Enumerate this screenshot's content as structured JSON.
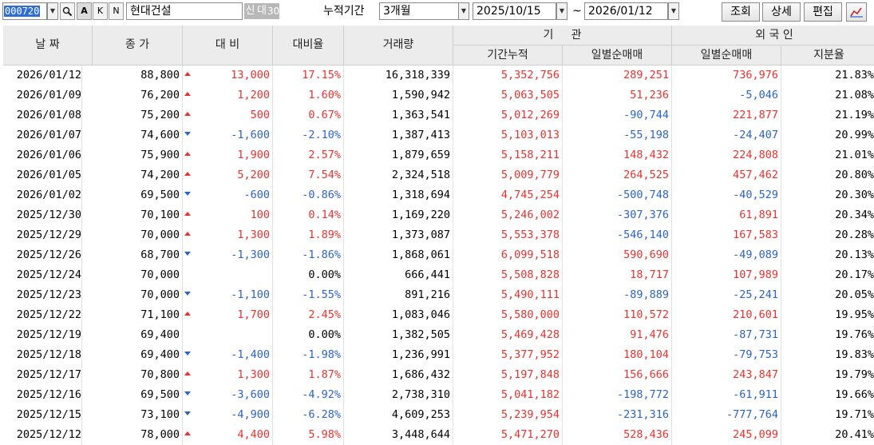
{
  "toolbar": {
    "code": "000720",
    "btn_search_icon": "magnifier-icon",
    "btn_a": "A",
    "btn_k": "K",
    "btn_n": "N",
    "name": "현대건설",
    "tag_new": "신",
    "tag_loan": "대",
    "tag_30": "30",
    "period_label": "누적기간",
    "period_value": "3개월",
    "date_from": "2025/10/15",
    "tilde": "~",
    "date_to": "2026/01/12",
    "btn_query": "조회",
    "btn_detail": "상세",
    "btn_edit": "편집"
  },
  "headers": {
    "date": "날 짜",
    "close": "종 가",
    "change": "대 비",
    "change_rate": "대비율",
    "volume": "거래량",
    "institution": "기     관",
    "inst_cum": "기간누적",
    "inst_daily": "일별순매매",
    "foreign": "외 국 인",
    "frgn_daily": "일별순매매",
    "frgn_share": "지분율"
  },
  "colors": {
    "up": "#e8322e",
    "down": "#2b63c6",
    "header_bg": "#ececec",
    "select_blue": "#2f6fd4"
  },
  "rows": [
    {
      "date": "2026/01/12",
      "close": "88,800",
      "dir": "up",
      "change": "13,000",
      "rate": "17.15%",
      "volume": "16,318,339",
      "inst_cum": "5,352,756",
      "inst_daily": "289,251",
      "frgn_daily": "736,976",
      "share": "21.83%"
    },
    {
      "date": "2026/01/09",
      "close": "76,200",
      "dir": "up",
      "change": "1,200",
      "rate": "1.60%",
      "volume": "1,590,942",
      "inst_cum": "5,063,505",
      "inst_daily": "51,236",
      "frgn_daily": "-5,046",
      "share": "21.08%"
    },
    {
      "date": "2026/01/08",
      "close": "75,200",
      "dir": "up",
      "change": "500",
      "rate": "0.67%",
      "volume": "1,363,541",
      "inst_cum": "5,012,269",
      "inst_daily": "-90,744",
      "frgn_daily": "221,877",
      "share": "21.19%"
    },
    {
      "date": "2026/01/07",
      "close": "74,600",
      "dir": "down",
      "change": "-1,600",
      "rate": "-2.10%",
      "volume": "1,387,413",
      "inst_cum": "5,103,013",
      "inst_daily": "-55,198",
      "frgn_daily": "-24,407",
      "share": "20.99%"
    },
    {
      "date": "2026/01/06",
      "close": "75,900",
      "dir": "up",
      "change": "1,900",
      "rate": "2.57%",
      "volume": "1,879,659",
      "inst_cum": "5,158,211",
      "inst_daily": "148,432",
      "frgn_daily": "224,808",
      "share": "21.01%"
    },
    {
      "date": "2026/01/05",
      "close": "74,200",
      "dir": "up",
      "change": "5,200",
      "rate": "7.54%",
      "volume": "2,324,518",
      "inst_cum": "5,009,779",
      "inst_daily": "264,525",
      "frgn_daily": "457,462",
      "share": "20.80%"
    },
    {
      "date": "2026/01/02",
      "close": "69,500",
      "dir": "down",
      "change": "-600",
      "rate": "-0.86%",
      "volume": "1,318,694",
      "inst_cum": "4,745,254",
      "inst_daily": "-500,748",
      "frgn_daily": "-40,529",
      "share": "20.30%"
    },
    {
      "date": "2025/12/30",
      "close": "70,100",
      "dir": "up",
      "change": "100",
      "rate": "0.14%",
      "volume": "1,169,220",
      "inst_cum": "5,246,002",
      "inst_daily": "-307,376",
      "frgn_daily": "61,891",
      "share": "20.34%"
    },
    {
      "date": "2025/12/29",
      "close": "70,000",
      "dir": "up",
      "change": "1,300",
      "rate": "1.89%",
      "volume": "1,373,087",
      "inst_cum": "5,553,378",
      "inst_daily": "-546,140",
      "frgn_daily": "167,583",
      "share": "20.28%"
    },
    {
      "date": "2025/12/26",
      "close": "68,700",
      "dir": "down",
      "change": "-1,300",
      "rate": "-1.86%",
      "volume": "1,868,061",
      "inst_cum": "6,099,518",
      "inst_daily": "590,690",
      "frgn_daily": "-49,089",
      "share": "20.13%"
    },
    {
      "date": "2025/12/24",
      "close": "70,000",
      "dir": "flat",
      "change": "",
      "rate": "0.00%",
      "volume": "666,441",
      "inst_cum": "5,508,828",
      "inst_daily": "18,717",
      "frgn_daily": "107,989",
      "share": "20.17%"
    },
    {
      "date": "2025/12/23",
      "close": "70,000",
      "dir": "down",
      "change": "-1,100",
      "rate": "-1.55%",
      "volume": "891,216",
      "inst_cum": "5,490,111",
      "inst_daily": "-89,889",
      "frgn_daily": "-25,241",
      "share": "20.05%"
    },
    {
      "date": "2025/12/22",
      "close": "71,100",
      "dir": "up",
      "change": "1,700",
      "rate": "2.45%",
      "volume": "1,083,046",
      "inst_cum": "5,580,000",
      "inst_daily": "110,572",
      "frgn_daily": "210,601",
      "share": "19.95%"
    },
    {
      "date": "2025/12/19",
      "close": "69,400",
      "dir": "flat",
      "change": "",
      "rate": "0.00%",
      "volume": "1,382,505",
      "inst_cum": "5,469,428",
      "inst_daily": "91,476",
      "frgn_daily": "-87,731",
      "share": "19.76%"
    },
    {
      "date": "2025/12/18",
      "close": "69,400",
      "dir": "down",
      "change": "-1,400",
      "rate": "-1.98%",
      "volume": "1,236,991",
      "inst_cum": "5,377,952",
      "inst_daily": "180,104",
      "frgn_daily": "-79,753",
      "share": "19.83%"
    },
    {
      "date": "2025/12/17",
      "close": "70,800",
      "dir": "up",
      "change": "1,300",
      "rate": "1.87%",
      "volume": "1,686,432",
      "inst_cum": "5,197,848",
      "inst_daily": "156,666",
      "frgn_daily": "243,847",
      "share": "19.79%"
    },
    {
      "date": "2025/12/16",
      "close": "69,500",
      "dir": "down",
      "change": "-3,600",
      "rate": "-4.92%",
      "volume": "2,738,310",
      "inst_cum": "5,041,182",
      "inst_daily": "-198,772",
      "frgn_daily": "-61,911",
      "share": "19.66%"
    },
    {
      "date": "2025/12/15",
      "close": "73,100",
      "dir": "down",
      "change": "-4,900",
      "rate": "-6.28%",
      "volume": "4,609,253",
      "inst_cum": "5,239,954",
      "inst_daily": "-231,316",
      "frgn_daily": "-777,764",
      "share": "19.71%"
    },
    {
      "date": "2025/12/12",
      "close": "78,000",
      "dir": "up",
      "change": "4,400",
      "rate": "5.98%",
      "volume": "3,448,644",
      "inst_cum": "5,471,270",
      "inst_daily": "528,436",
      "frgn_daily": "245,099",
      "share": "20.41%"
    }
  ]
}
